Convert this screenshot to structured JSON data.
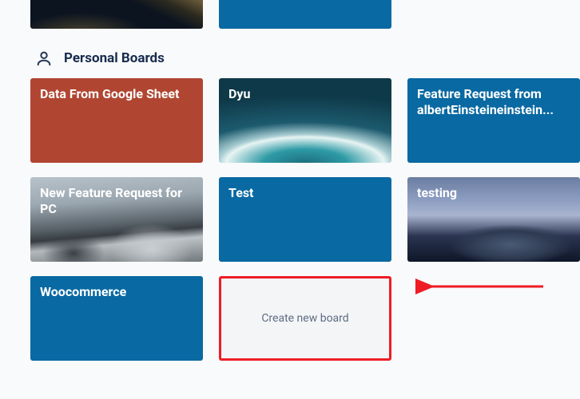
{
  "top_row": {
    "card1": {
      "type": "image-mountain-sunset"
    },
    "card2": {
      "type": "blue-solid"
    }
  },
  "section": {
    "title": "Personal Boards"
  },
  "boards": [
    {
      "title": "Data From Google Sheet",
      "style": "rust"
    },
    {
      "title": "Dyu",
      "style": "wave"
    },
    {
      "title": "Feature Request from albertEinsteineinstein...",
      "style": "blue"
    },
    {
      "title": "New Feature Request for PC",
      "style": "mountain2"
    },
    {
      "title": "Test",
      "style": "blue"
    },
    {
      "title": "testing",
      "style": "dome"
    },
    {
      "title": "Woocommerce",
      "style": "blue"
    }
  ],
  "create": {
    "label": "Create new board"
  },
  "colors": {
    "brand_blue": "#0969a2",
    "rust": "#b04632",
    "highlight_red": "#ee1c25"
  }
}
